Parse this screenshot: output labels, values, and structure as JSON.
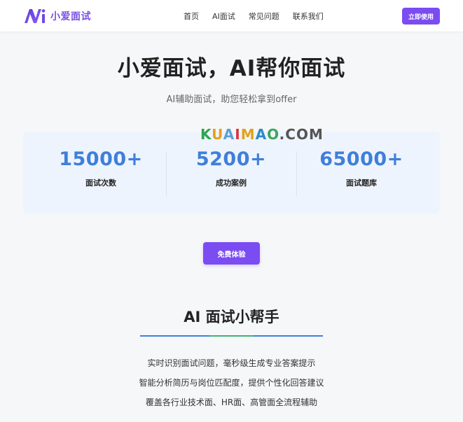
{
  "header": {
    "logo_text": "小爱面试",
    "nav": [
      "首页",
      "AI面试",
      "常见问题",
      "联系我们"
    ],
    "cta_label": "立即使用"
  },
  "hero": {
    "title": "小爱面试，AI帮你面试",
    "subtitle": "AI辅助面试，助您轻松拿到offer"
  },
  "watermark": "KUAIMAO.COM",
  "stats": [
    {
      "value": "15000+",
      "label": "面试次数"
    },
    {
      "value": "5200+",
      "label": "成功案例"
    },
    {
      "value": "65000+",
      "label": "面试题库"
    }
  ],
  "trial_label": "免费体验",
  "section": {
    "title": "AI 面试小帮手",
    "features": [
      "实时识别面试问题，毫秒级生成专业答案提示",
      "智能分析简历与岗位匹配度，提供个性化回答建议",
      "覆盖各行业技术面、HR面、高管面全流程辅助"
    ]
  },
  "colors": {
    "brand": "#7b4cf2",
    "stat_blue": "#3f7fdb",
    "stats_bg": "#eef4fd"
  }
}
